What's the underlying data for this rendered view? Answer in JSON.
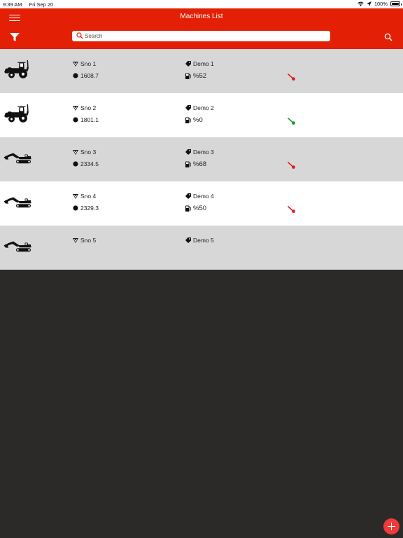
{
  "status_bar": {
    "time": "9:39 AM",
    "date": "Fri Sep 20",
    "battery": "100%"
  },
  "header": {
    "title": "Machines List",
    "search_placeholder": "Search",
    "menu_icon": "hamburger-menu-icon",
    "filter_icon": "filter-funnel-icon",
    "search_icon": "magnifier-icon"
  },
  "colors": {
    "accent": "#e32005",
    "row_shaded": "#d8d7d7",
    "row_plain": "#ffffff",
    "background": "#2b2a29",
    "gauge_red": "#e31b1b",
    "gauge_green": "#1f9a2e",
    "fab": "#ef3b3a"
  },
  "machines": [
    {
      "type": "backhoe",
      "sno": "Sno 1",
      "hours": "1608.7",
      "name": "Demo 1",
      "fuel": "%52",
      "gauge_color": "red"
    },
    {
      "type": "backhoe",
      "sno": "Sno 2",
      "hours": "1801.1",
      "name": "Demo 2",
      "fuel": "%0",
      "gauge_color": "green"
    },
    {
      "type": "excavator",
      "sno": "Sno 3",
      "hours": "2334.5",
      "name": "Demo 3",
      "fuel": "%68",
      "gauge_color": "red"
    },
    {
      "type": "excavator",
      "sno": "Sno 4",
      "hours": "2329.3",
      "name": "Demo 4",
      "fuel": "%50",
      "gauge_color": "red"
    },
    {
      "type": "excavator",
      "sno": "Sno 5",
      "hours": "",
      "name": "Demo 5",
      "fuel": "",
      "gauge_color": ""
    }
  ],
  "fab": {
    "icon": "plus-icon"
  }
}
